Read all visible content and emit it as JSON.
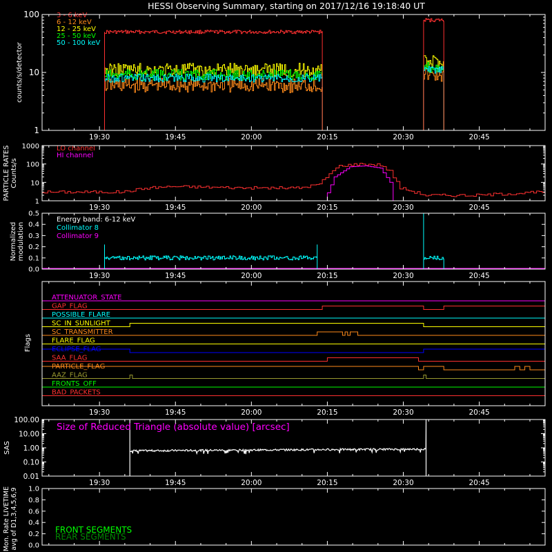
{
  "title": "HESSI Observing Summary, starting on 2017/12/16 19:18:40 UT",
  "time_axis": {
    "start": "19:18:40",
    "end": "20:58:00",
    "ticks": [
      "19:30",
      "19:45",
      "20:00",
      "20:15",
      "20:30",
      "20:45"
    ]
  },
  "colors": {
    "frame": "#ffffff",
    "red": "#ff3030",
    "orange": "#ff8a1a",
    "yellow": "#ffff00",
    "green": "#00ff00",
    "cyan": "#00ffff",
    "magenta": "#ff00ff",
    "pink": "#ff2a6a",
    "blue": "#0000ff",
    "olive": "#9a9a30"
  },
  "chart_data": [
    {
      "type": "line",
      "name": "count-rates",
      "ylabel": "counts/s/detector",
      "yscale": "log",
      "ylim": [
        1,
        100
      ],
      "yticks": [
        "1",
        "10",
        "100"
      ],
      "legend_placement": "top-left",
      "series": [
        {
          "name": "3 - 6 keV",
          "color": "#ff3030",
          "segments": [
            {
              "t": [
                "19:31",
                "20:14"
              ],
              "value": 50
            },
            {
              "t": [
                "20:34",
                "20:38"
              ],
              "value": 80
            }
          ]
        },
        {
          "name": "6 - 12 keV",
          "color": "#ff8a1a",
          "segments": [
            {
              "t": [
                "19:31",
                "20:14"
              ],
              "value": 6
            },
            {
              "t": [
                "20:34",
                "20:38"
              ],
              "value": 9
            }
          ]
        },
        {
          "name": "12 - 25 keV",
          "color": "#ffff00",
          "segments": [
            {
              "t": [
                "19:31",
                "20:14"
              ],
              "value": 11
            },
            {
              "t": [
                "20:34",
                "20:38"
              ],
              "value": 15
            }
          ]
        },
        {
          "name": "25 - 50 keV",
          "color": "#00ff00",
          "segments": [
            {
              "t": [
                "19:31",
                "20:14"
              ],
              "value": 9
            },
            {
              "t": [
                "20:34",
                "20:38"
              ],
              "value": 12
            }
          ]
        },
        {
          "name": "50 - 100 keV",
          "color": "#00ffff",
          "segments": [
            {
              "t": [
                "19:31",
                "20:14"
              ],
              "value": 8
            },
            {
              "t": [
                "20:34",
                "20:38"
              ],
              "value": 11
            }
          ]
        }
      ]
    },
    {
      "type": "line",
      "name": "particle-rates",
      "ylabel": "PARTICLE RATES Counts/s",
      "yscale": "log",
      "ylim": [
        1,
        1000
      ],
      "yticks": [
        "1",
        "10",
        "100",
        "1000"
      ],
      "series": [
        {
          "name": "LO channel",
          "color": "#ff3030",
          "points": [
            [
              "19:18:40",
              3
            ],
            [
              "19:35",
              3
            ],
            [
              "19:40",
              5
            ],
            [
              "19:45",
              6
            ],
            [
              "20:00",
              5
            ],
            [
              "20:10",
              5
            ],
            [
              "20:14",
              8
            ],
            [
              "20:16",
              30
            ],
            [
              "20:18",
              80
            ],
            [
              "20:22",
              100
            ],
            [
              "20:26",
              90
            ],
            [
              "20:28",
              40
            ],
            [
              "20:30",
              5
            ],
            [
              "20:35",
              2
            ],
            [
              "20:45",
              2
            ],
            [
              "20:58",
              3
            ]
          ]
        },
        {
          "name": "HI channel",
          "color": "#ff00ff",
          "points": [
            [
              "19:18:40",
              1
            ],
            [
              "20:15",
              1
            ],
            [
              "20:17",
              20
            ],
            [
              "20:20",
              70
            ],
            [
              "20:23",
              80
            ],
            [
              "20:26",
              60
            ],
            [
              "20:28",
              10
            ],
            [
              "20:29",
              1
            ],
            [
              "20:58",
              1
            ]
          ]
        }
      ]
    },
    {
      "type": "line",
      "name": "modulation",
      "ylabel": "Normalized modulation",
      "ylim": [
        0,
        0.5
      ],
      "yticks": [
        "0.0",
        "0.1",
        "0.2",
        "0.3",
        "0.4",
        "0.5"
      ],
      "annotation": "Energy band: 6-12 keV",
      "series": [
        {
          "name": "Collimator 8",
          "color": "#00ffff",
          "segments": [
            {
              "t": [
                "19:31",
                "20:13"
              ],
              "value": 0.1
            },
            {
              "t": [
                "20:34",
                "20:38"
              ],
              "value": 0.1
            }
          ]
        },
        {
          "name": "Collimator 9",
          "color": "#ff00ff",
          "segments": [
            {
              "t": [
                "19:18:40",
                "20:58"
              ],
              "value": 0.0
            }
          ]
        }
      ]
    },
    {
      "type": "line",
      "name": "flags",
      "ylabel": "Flags",
      "series": [
        {
          "name": "ATTENUATOR_STATE",
          "color": "#ff00ff",
          "on": []
        },
        {
          "name": "GAP_FLAG",
          "color": "#ff3030",
          "on": [
            [
              "20:14",
              "20:34"
            ],
            [
              "20:38",
              "20:58"
            ]
          ]
        },
        {
          "name": "POSSIBLE_FLARE",
          "color": "#00ffff",
          "on": []
        },
        {
          "name": "SC_IN_SUNLIGHT",
          "color": "#ffff00",
          "on": [
            [
              "19:36",
              "20:34"
            ]
          ]
        },
        {
          "name": "SC_TRANSMITTER",
          "color": "#ff8a1a",
          "on": [
            [
              "20:13",
              "20:18"
            ],
            [
              "20:18:30",
              "20:19"
            ],
            [
              "20:19:30",
              "20:21"
            ]
          ]
        },
        {
          "name": "FLARE_FLAG",
          "color": "#ffff00",
          "on": []
        },
        {
          "name": "ECLIPSE_FLAG",
          "color": "#0000ff",
          "on": [
            [
              "19:18:40",
              "19:36"
            ],
            [
              "20:34",
              "20:58"
            ]
          ]
        },
        {
          "name": "SAA_FLAG",
          "color": "#ff3030",
          "on": [
            [
              "20:15",
              "20:33"
            ]
          ]
        },
        {
          "name": "PARTICLE_FLAG",
          "color": "#ff8a1a",
          "on": [
            [
              "19:18:40",
              "20:33"
            ],
            [
              "20:34",
              "20:38"
            ],
            [
              "20:52",
              "20:53"
            ],
            [
              "20:54",
              "20:55"
            ]
          ]
        },
        {
          "name": "AAZ_FLAG",
          "color": "#9a9a30",
          "on": [
            [
              "19:36",
              "19:36:30"
            ],
            [
              "20:34",
              "20:34:30"
            ]
          ]
        },
        {
          "name": "FRONTS_OFF",
          "color": "#00ff00",
          "on": []
        },
        {
          "name": "BAD_PACKETS",
          "color": "#ff3030",
          "on": []
        }
      ]
    },
    {
      "type": "line",
      "name": "sas",
      "ylabel": "SAS",
      "yscale": "log",
      "ylim": [
        0.01,
        100
      ],
      "yticks": [
        "0.01",
        "0.10",
        "1.00",
        "10.00",
        "100.00"
      ],
      "annotation": "Size of Reduced Triangle (absolute value) [arcsec]",
      "series": [
        {
          "name": "Size of Reduced Triangle",
          "color": "#ffffff",
          "points": [
            [
              "19:36",
              100
            ],
            [
              "19:36:30",
              0.6
            ],
            [
              "19:50",
              0.7
            ],
            [
              "20:10",
              0.75
            ],
            [
              "20:30",
              0.8
            ],
            [
              "20:34",
              0.8
            ],
            [
              "20:34:30",
              100
            ]
          ]
        }
      ]
    },
    {
      "type": "line",
      "name": "livetime",
      "ylabel": "Mon. Rate LIVETIME avg of D1,3,4,5,6,9",
      "ylim": [
        0,
        1
      ],
      "yticks": [
        "0.0",
        "0.2",
        "0.4",
        "0.6",
        "0.8",
        "1.0"
      ],
      "legend_placement": "bottom-left",
      "series": [
        {
          "name": "FRONT SEGMENTS",
          "color": "#00ff00",
          "points": []
        },
        {
          "name": "REAR SEGMENTS",
          "color": "#008800",
          "points": []
        }
      ]
    }
  ]
}
